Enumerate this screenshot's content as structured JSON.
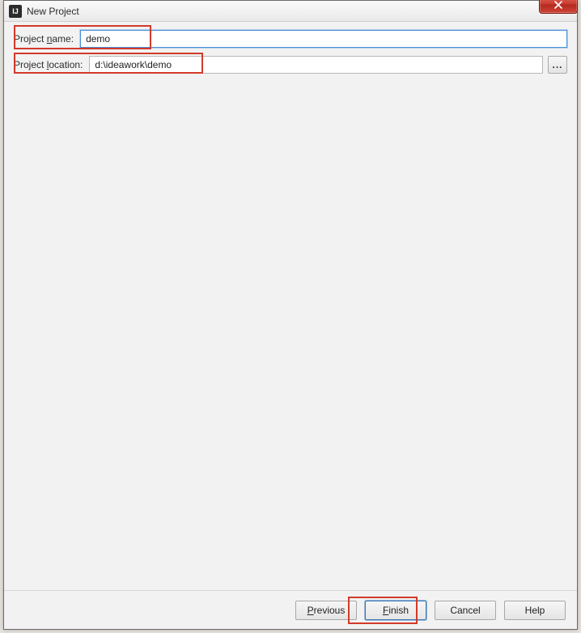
{
  "window": {
    "title": "New Project",
    "app_icon_text": "IJ"
  },
  "fields": {
    "project_name": {
      "label_pre": "Project ",
      "label_mn": "n",
      "label_post": "ame:",
      "value": "demo"
    },
    "project_location": {
      "label_pre": "Project ",
      "label_mn": "l",
      "label_post": "ocation:",
      "value": "d:\\ideawork\\demo",
      "browse_label": "..."
    }
  },
  "buttons": {
    "previous": {
      "mn": "P",
      "rest": "revious"
    },
    "finish": {
      "mn": "F",
      "rest": "inish"
    },
    "cancel": {
      "text": "Cancel"
    },
    "help": {
      "text": "Help"
    }
  }
}
